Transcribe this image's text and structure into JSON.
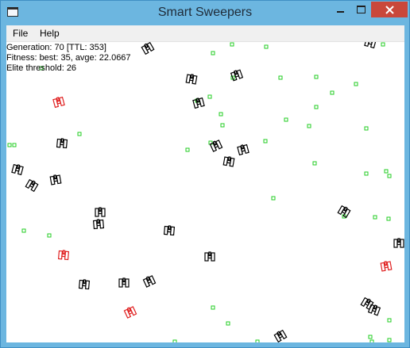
{
  "window": {
    "title": "Smart Sweepers",
    "icons": {
      "app": "app-window-icon",
      "minimize": "minimize-icon",
      "maximize": "maximize-icon",
      "close": "close-icon"
    },
    "close_color": "#c9483b",
    "title_bar_color": "#6cb6e0"
  },
  "menu": {
    "file": "File",
    "help": "Help"
  },
  "stats": {
    "generation_line": "Generation: 70 [TTL: 353]",
    "fitness_line": "Fitness: best: 35, avge: 22.0667",
    "elite_line": "Elite threshold: 26"
  },
  "colors": {
    "mine": "#22cc22",
    "sweeper": "#000000",
    "elite_sweeper": "#e02020"
  }
}
